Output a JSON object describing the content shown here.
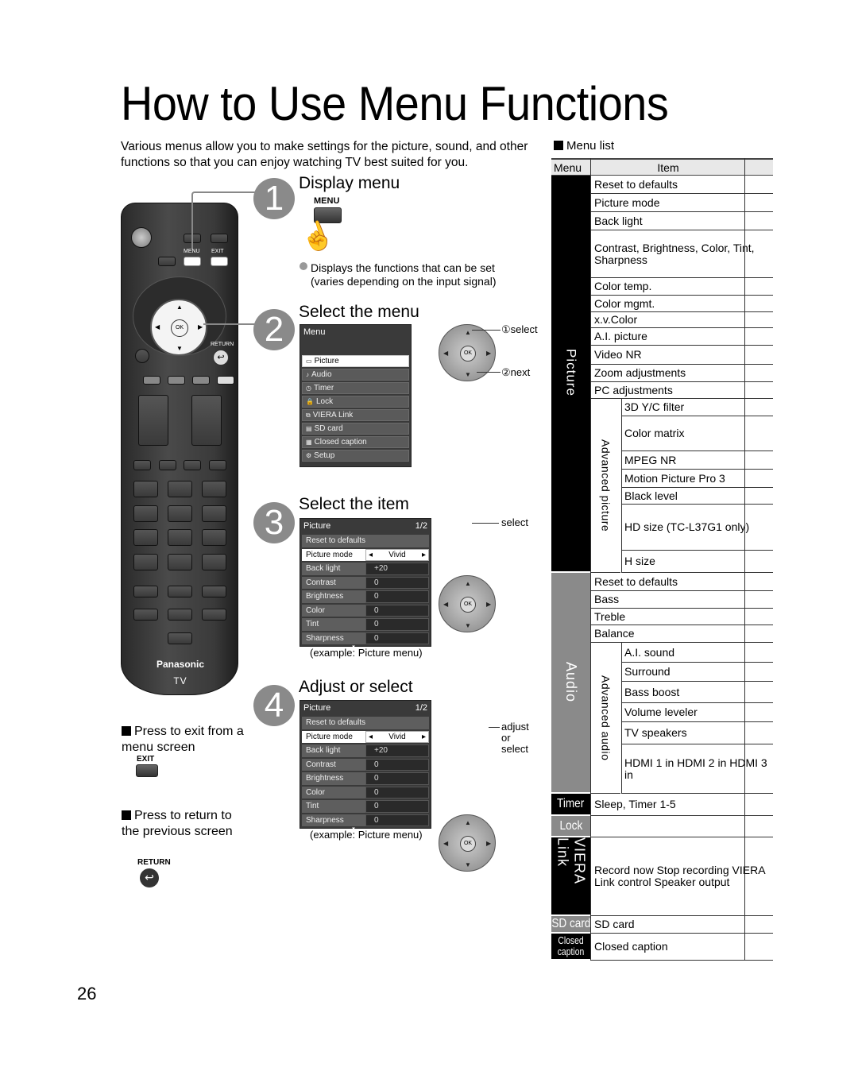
{
  "page": {
    "title": "How to Use Menu Functions",
    "intro": "Various menus allow you to make settings for the picture, sound, and other functions so that you can enjoy watching TV best suited for you.",
    "page_number": "26"
  },
  "remote": {
    "menu_label": "MENU",
    "exit_label": "EXIT",
    "ok_label": "OK",
    "return_label": "RETURN",
    "brand": "Panasonic",
    "model": "TV"
  },
  "steps": [
    {
      "number": "1",
      "title": "Display menu",
      "button_label": "MENU",
      "note": "Displays the functions that can be set (varies depending on the input signal)"
    },
    {
      "number": "2",
      "title": "Select the menu",
      "screen_title": "Menu",
      "menu_items": [
        "Picture",
        "Audio",
        "Timer",
        "Lock",
        "VIERA Link",
        "SD card",
        "Closed caption",
        "Setup"
      ],
      "selected_index": 0,
      "dpad_labels": {
        "up": "①select",
        "ok": "②next"
      }
    },
    {
      "number": "3",
      "title": "Select the item",
      "screen_title": "Picture",
      "page": "1/2",
      "dpad_labels": {
        "up": "select"
      },
      "caption": "(example:  Picture menu)"
    },
    {
      "number": "4",
      "title": "Adjust or select",
      "screen_title": "Picture",
      "page": "1/2",
      "dpad_labels": {
        "right": "adjust\nor\nselect",
        "right_lines": [
          "adjust",
          "or",
          "select"
        ]
      },
      "caption": "(example:  Picture menu)"
    }
  ],
  "picture_menu_rows": [
    {
      "label": "Reset to defaults",
      "value": null
    },
    {
      "label": "Picture mode",
      "value": "Vivid",
      "selected": true
    },
    {
      "label": "Back light",
      "value": "+20"
    },
    {
      "label": "Contrast",
      "value": "0"
    },
    {
      "label": "Brightness",
      "value": "0"
    },
    {
      "label": "Color",
      "value": "0"
    },
    {
      "label": "Tint",
      "value": "0"
    },
    {
      "label": "Sharpness",
      "value": "0"
    }
  ],
  "notes": {
    "exit": {
      "text": "Press to exit from a menu screen",
      "button_label": "EXIT"
    },
    "return": {
      "text": "Press to return to the previous screen",
      "button_label": "RETURN"
    }
  },
  "menu_list": {
    "title": "Menu list",
    "headers": {
      "menu": "Menu",
      "item": "Item"
    },
    "sections": [
      {
        "menu": "Picture",
        "items": [
          "Reset to defaults",
          "Picture mode",
          "Back light",
          "Contrast, Brightness, Color, Tint, Sharpness",
          "Color temp.",
          "Color mgmt.",
          "x.v.Color",
          "A.I. picture",
          "Video NR",
          "Zoom adjustments",
          "PC adjustments"
        ],
        "sub": {
          "label": "Advanced picture",
          "items": [
            "3D Y/C filter",
            "Color matrix",
            "MPEG NR",
            "Motion Picture Pro 3",
            "Black level",
            "HD size (TC-L37G1 only)",
            "H size"
          ]
        }
      },
      {
        "menu": "Audio",
        "items": [
          "Reset to defaults",
          "Bass",
          "Treble",
          "Balance"
        ],
        "sub": {
          "label": "Advanced audio",
          "items": [
            "A.I. sound",
            "Surround",
            "Bass boost",
            "Volume leveler",
            "TV speakers",
            "HDMI 1 in HDMI 2 in HDMI 3 in"
          ]
        }
      },
      {
        "menu": "Timer",
        "items": [
          "Sleep, Timer 1-5"
        ]
      },
      {
        "menu": "Lock",
        "items": [
          ""
        ]
      },
      {
        "menu": "VIERA Link",
        "items": [
          "Record now Stop recording VIERA Link control Speaker output"
        ]
      },
      {
        "menu": "SD card",
        "items": [
          "SD card"
        ]
      },
      {
        "menu": "Closed caption",
        "items": [
          "Closed caption"
        ]
      }
    ],
    "colors": {
      "dark": "#000000",
      "gray": "#8a8a8a",
      "header_bg": "#e8e8e8"
    }
  }
}
